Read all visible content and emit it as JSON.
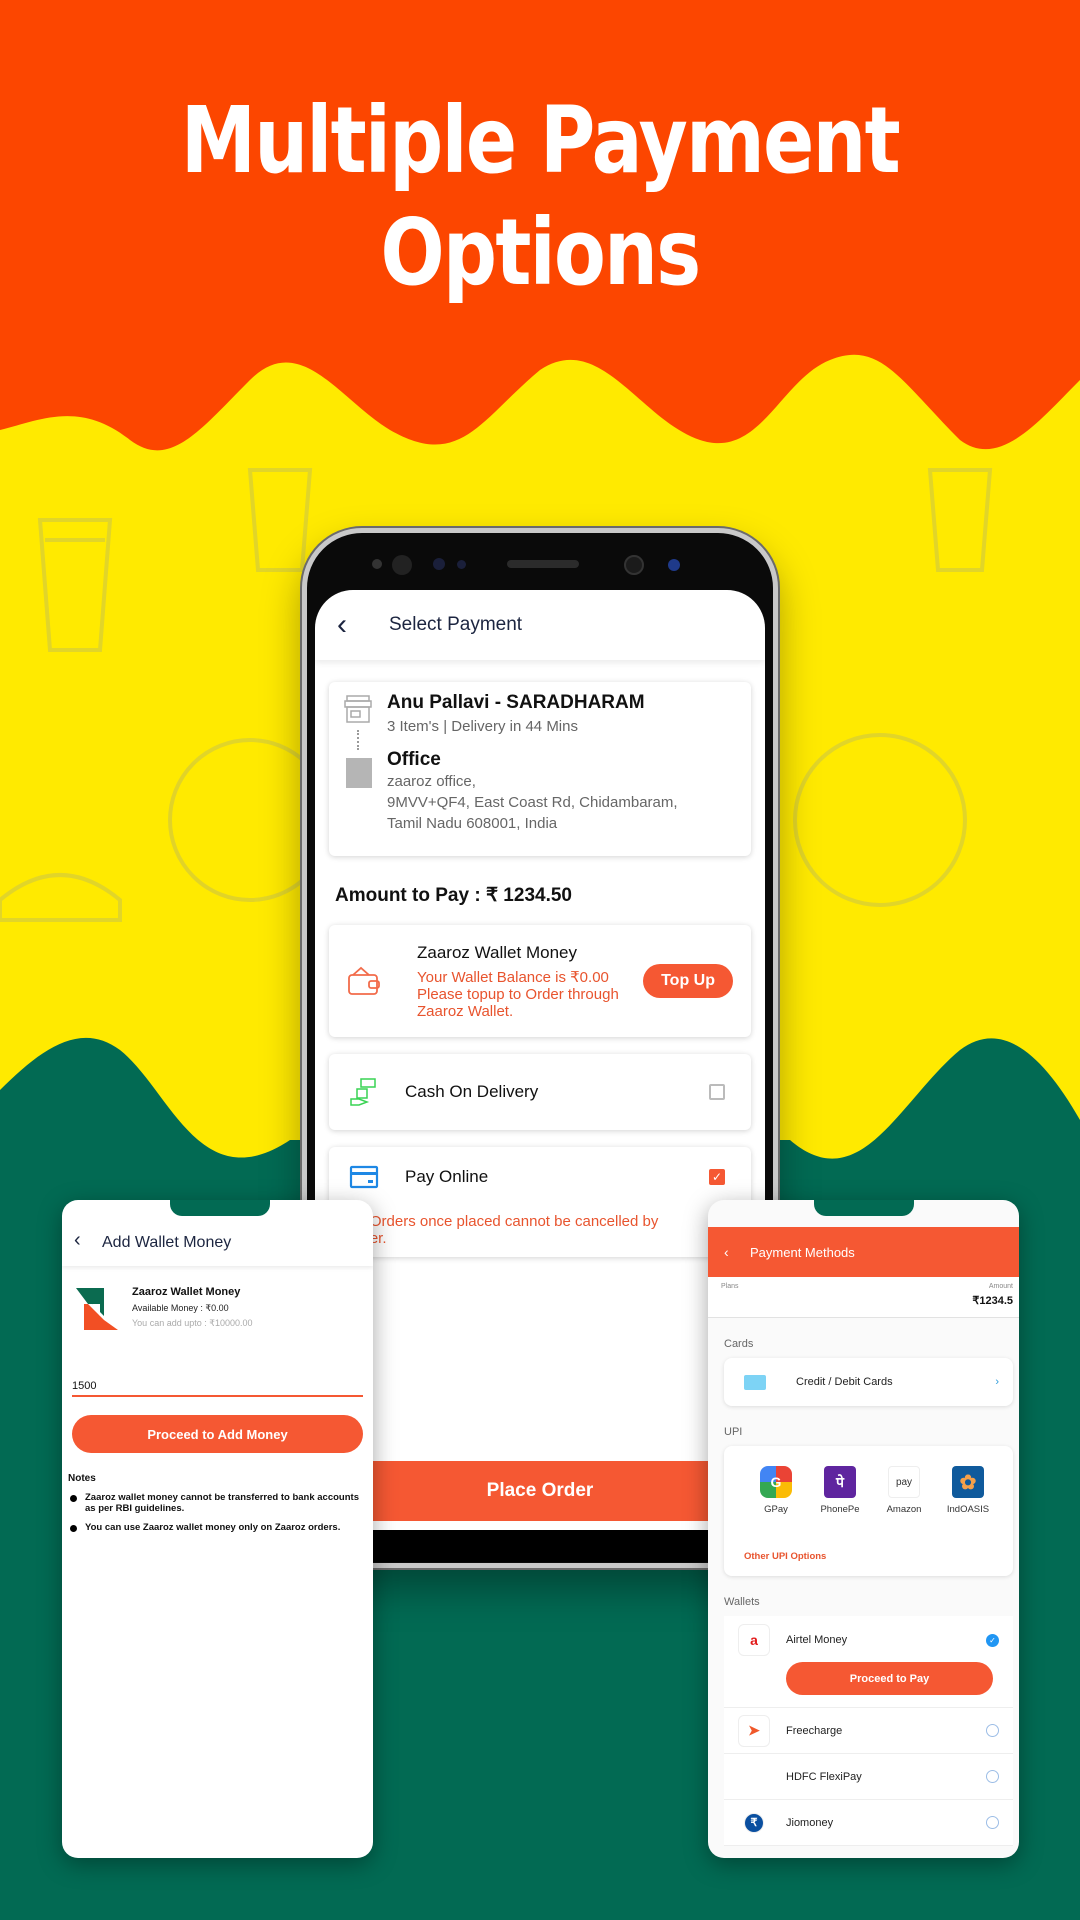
{
  "headline": {
    "line1": "Multiple Payment",
    "line2": "Options"
  },
  "colors": {
    "top_band": "#fc4600",
    "mid_band": "#ffea00",
    "bottom_band": "#026a53",
    "accent": "#f55833"
  },
  "select_payment": {
    "title": "Select Payment",
    "back_icon": "chevron-left-icon",
    "restaurant": {
      "name": "Anu Pallavi - SARADHARAM",
      "details": "3 Item's | Delivery in 44 Mins",
      "icon": "store-icon"
    },
    "address": {
      "label": "Office",
      "line1": "zaaroz office,",
      "line2": "9MVV+QF4, East Coast Rd, Chidambaram,",
      "line3": "Tamil Nadu 608001, India",
      "icon": "building-icon"
    },
    "amount_to_pay": "Amount to Pay : ₹ 1234.50",
    "wallet": {
      "title": "Zaaroz Wallet Money",
      "message_line1": "Your Wallet Balance is ₹0.00",
      "message_line2": "Please topup to Order through",
      "message_line3": "Zaaroz Wallet.",
      "top_up_label": "Top Up",
      "icon": "wallet-icon"
    },
    "options": [
      {
        "label": "Cash On Delivery",
        "icon": "cash-hand-icon",
        "checked": false
      },
      {
        "label": "Pay Online",
        "icon": "credit-card-icon",
        "checked": true
      }
    ],
    "warning_line1": "he Orders once placed cannot be cancelled by",
    "warning_line2": "omer.",
    "place_order_label": "Place Order"
  },
  "add_wallet": {
    "title": "Add Wallet Money",
    "wallet_name": "Zaaroz Wallet Money",
    "available": "Available Money : ₹0.00",
    "limit": "You can add upto : ₹10000.00",
    "amount_value": "1500",
    "proceed_label": "Proceed to Add Money",
    "notes_heading": "Notes",
    "notes": [
      "Zaaroz wallet money cannot be transferred to bank accounts as per RBI guidelines.",
      "You can use Zaaroz wallet money only on Zaaroz orders."
    ]
  },
  "payment_methods": {
    "title": "Payment Methods",
    "plans_label": "Plans",
    "amount_label": "Amount",
    "amount_value": "₹1234.5",
    "cards_heading": "Cards",
    "card_option": "Credit / Debit Cards",
    "upi_heading": "UPI",
    "upi_apps": [
      {
        "name": "GPay",
        "glyph": "G"
      },
      {
        "name": "PhonePe",
        "glyph": "पे"
      },
      {
        "name": "Amazon",
        "glyph": "pay"
      },
      {
        "name": "IndOASIS",
        "glyph": "✿"
      }
    ],
    "other_upi": "Other UPI Options",
    "wallets_heading": "Wallets",
    "wallets": [
      {
        "name": "Airtel Money",
        "glyph": "a",
        "selected": true
      },
      {
        "name": "Freecharge",
        "glyph": "➤",
        "selected": false
      },
      {
        "name": "HDFC FlexiPay",
        "glyph": "",
        "selected": false
      },
      {
        "name": "Jiomoney",
        "glyph": "₹",
        "selected": false
      }
    ],
    "proceed_to_pay": "Proceed to Pay"
  }
}
